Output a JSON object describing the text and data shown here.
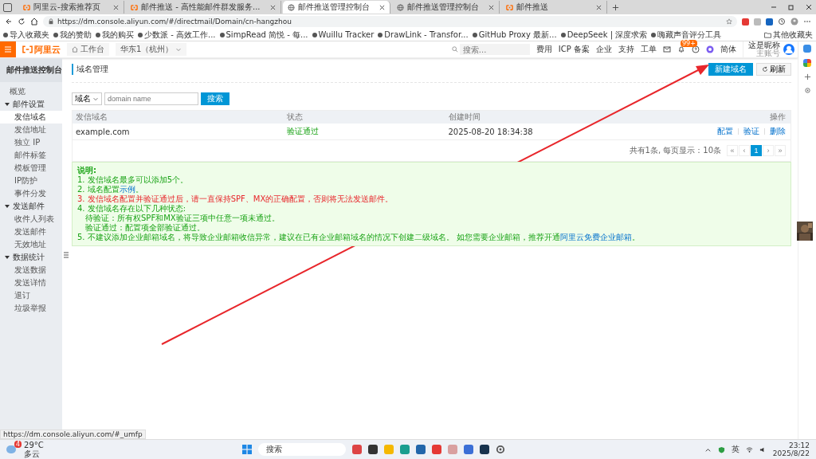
{
  "browser": {
    "tabs": [
      {
        "title": "阿里云-搜索推荐页",
        "kind": "aliyun",
        "selected": false
      },
      {
        "title": "邮件推送 - 高性能邮件群发服务...",
        "kind": "aliyun",
        "selected": false
      },
      {
        "title": "邮件推送管理控制台",
        "kind": "globe",
        "selected": true
      },
      {
        "title": "邮件推送管理控制台",
        "kind": "globe",
        "selected": false
      },
      {
        "title": "邮件推送",
        "kind": "aliyun",
        "selected": false
      }
    ],
    "address": "https://dm.console.aliyun.com/#/directmail/Domain/cn-hangzhou",
    "bookmarks": [
      "导入收藏夹",
      "我的赞助",
      "我的购买",
      "少数派 - 高效工作...",
      "SimpRead 简悦 - 每...",
      "Wuillu Tracker",
      "DrawLink - Transfor...",
      "GitHub Proxy 最新...",
      "DeepSeek | 深度求索",
      "嗨藏声音评分工具"
    ],
    "other_bookmarks": "其他收藏夹"
  },
  "header": {
    "logo": "阿里云",
    "workbench": "工作台",
    "region": "华东1（杭州）",
    "search_placeholder": "搜索...",
    "links": [
      "费用",
      "ICP 备案",
      "企业",
      "支持",
      "工单"
    ],
    "badge": "99+",
    "language": "简体",
    "user_name": "这是昵称",
    "user_role": "主账号"
  },
  "sidebar": {
    "title": "邮件推送控制台",
    "items": [
      {
        "label": "概览",
        "selected": false
      },
      {
        "label": "邮件设置",
        "expanded": true,
        "children": [
          {
            "label": "发信域名",
            "selected": true
          },
          {
            "label": "发信地址",
            "selected": false
          },
          {
            "label": "独立 IP",
            "selected": false
          },
          {
            "label": "邮件标签",
            "selected": false
          },
          {
            "label": "模板管理",
            "selected": false
          },
          {
            "label": "IP防护",
            "selected": false
          },
          {
            "label": "事件分发",
            "selected": false
          }
        ]
      },
      {
        "label": "发送邮件",
        "expanded": true,
        "children": [
          {
            "label": "收件人列表",
            "selected": false
          },
          {
            "label": "发送邮件",
            "selected": false
          },
          {
            "label": "无效地址",
            "selected": false
          }
        ]
      },
      {
        "label": "数据统计",
        "expanded": true,
        "children": [
          {
            "label": "发送数据",
            "selected": false
          },
          {
            "label": "发送详情",
            "selected": false
          },
          {
            "label": "退订",
            "selected": false
          },
          {
            "label": "垃圾举报",
            "selected": false
          }
        ]
      }
    ]
  },
  "page": {
    "title": "域名管理",
    "create_button": "新建域名",
    "refresh_button": "刷新",
    "filter": {
      "field": "域名",
      "placeholder": "domain name",
      "button": "搜索"
    },
    "table": {
      "columns": [
        "发信域名",
        "状态",
        "创建时间",
        "操作"
      ],
      "rows": [
        {
          "domain": "example.com",
          "status": "验证通过",
          "created": "2025-08-20 18:34:38",
          "actions": [
            "配置",
            "验证",
            "删除"
          ]
        }
      ]
    },
    "pagination": {
      "summary": "共有1条, 每页显示：10条",
      "pages": [
        {
          "label": "«",
          "selected": false
        },
        {
          "label": "‹",
          "selected": false
        },
        {
          "label": "1",
          "selected": true
        },
        {
          "label": "›",
          "selected": false
        },
        {
          "label": "»",
          "selected": false
        }
      ]
    },
    "notes": {
      "title": "说明:",
      "lines": [
        {
          "kind": "normal",
          "parts": [
            {
              "text": "1. 发信域名最多可以添加5个。",
              "link": false
            }
          ]
        },
        {
          "kind": "normal",
          "parts": [
            {
              "text": "2. 域名配置",
              "link": false
            },
            {
              "text": "示例",
              "link": true
            },
            {
              "text": "。",
              "link": false
            }
          ]
        },
        {
          "kind": "alert",
          "parts": [
            {
              "text": "3. 发信域名配置并验证通过后，请一直保持SPF、MX的正确配置，否则将无法发送邮件。",
              "link": false
            }
          ]
        },
        {
          "kind": "normal",
          "parts": [
            {
              "text": "4. 发信域名存在以下几种状态:",
              "link": false
            }
          ]
        },
        {
          "kind": "indent",
          "parts": [
            {
              "text": "待验证：所有权SPF和MX验证三项中任意一项未通过。",
              "link": false
            }
          ]
        },
        {
          "kind": "indent",
          "parts": [
            {
              "text": "验证通过：配置项全部验证通过。",
              "link": false
            }
          ]
        },
        {
          "kind": "normal",
          "parts": [
            {
              "text": "5. 不建议添加企业邮箱域名，将导致企业邮箱收信异常，建议在已有企业邮箱域名的情况下创建二级域名。 如您需要企业邮箱，推荐开通",
              "link": false
            },
            {
              "text": "阿里云免费企业邮箱",
              "link": true
            },
            {
              "text": "。",
              "link": false
            }
          ]
        }
      ]
    }
  },
  "status_url": "https://dm.console.aliyun.com/#_umfp",
  "taskbar": {
    "weather_badge": "4",
    "weather_temp": "29°C",
    "weather_desc": "多云",
    "search": "搜索",
    "ime": "英",
    "time": "23:12",
    "date": "2025/8/22"
  }
}
